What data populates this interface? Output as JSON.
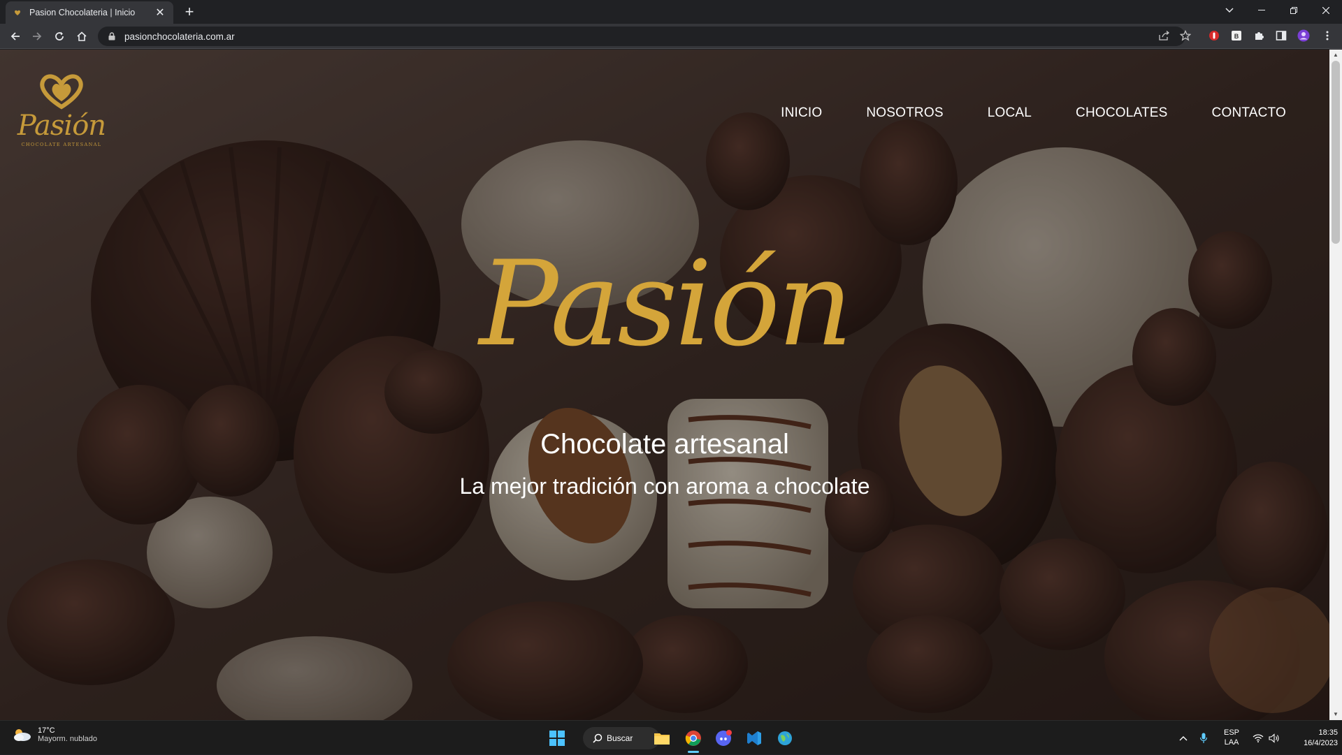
{
  "browser": {
    "tab_title": "Pasion Chocolateria | Inicio",
    "tab_close": "✕",
    "new_tab": "+",
    "url": "pasionchocolateria.com.ar"
  },
  "site": {
    "logo_word": "Pasión",
    "logo_tagline": "CHOCOLATE ARTESANAL",
    "nav": [
      "INICIO",
      "NOSOTROS",
      "LOCAL",
      "CHOCOLATES",
      "CONTACTO"
    ],
    "hero_title": "Pasión",
    "hero_subtitle": "Chocolate artesanal",
    "hero_tagline": "La mejor tradición con aroma a chocolate"
  },
  "taskbar": {
    "weather_temp": "17°C",
    "weather_desc": "Mayorm. nublado",
    "search_label": "Buscar",
    "lang_top": "ESP",
    "lang_bottom": "LAA",
    "time": "18:35",
    "date": "16/4/2023"
  },
  "colors": {
    "gold": "#d4a53a",
    "chrome_dark": "#202124",
    "chrome_toolbar": "#35363a"
  }
}
